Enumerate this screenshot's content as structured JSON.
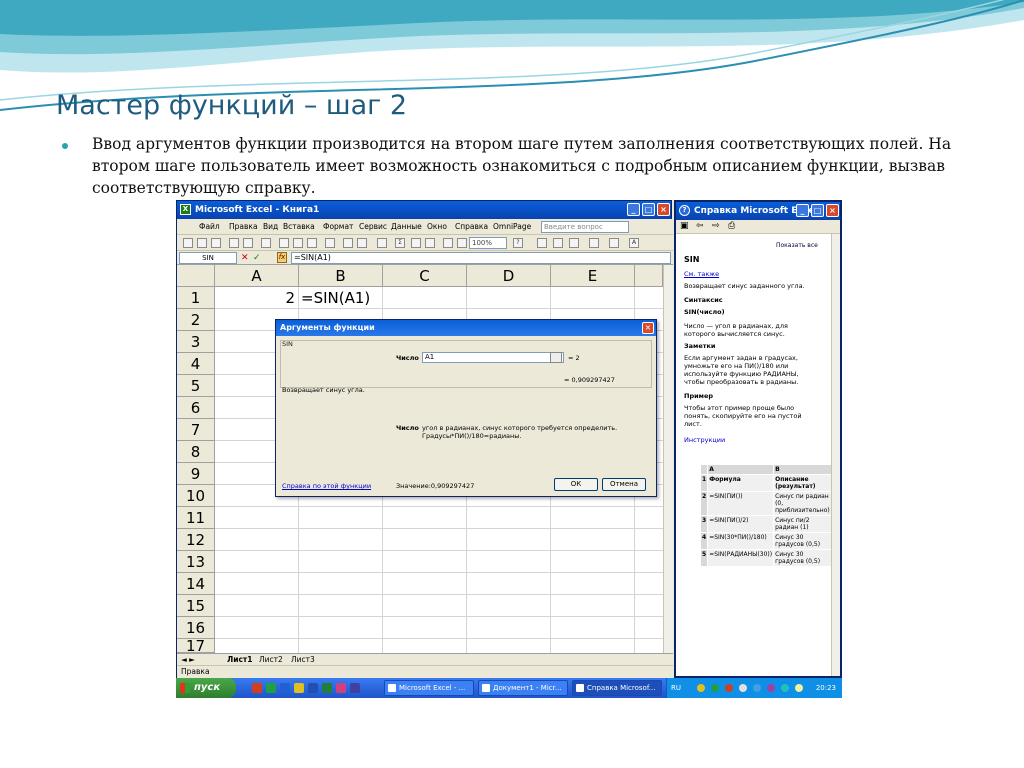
{
  "slide": {
    "title": "Мастер функций – шаг 2",
    "bullet": "Ввод аргументов функции производится на втором шаге путем заполнения соответствующих полей. На втором шаге пользователь имеет возможность ознакомиться с подробным описанием функции, вызвав соответствующую справку."
  },
  "excel": {
    "window_title": "Microsoft Excel - Книга1",
    "menu": [
      "Файл",
      "Правка",
      "Вид",
      "Вставка",
      "Формат",
      "Сервис",
      "Данные",
      "Окно",
      "Справка",
      "OmniPage"
    ],
    "ask_placeholder": "Введите вопрос",
    "zoom": "100%",
    "name_box": "SIN",
    "formula": "=SIN(A1)",
    "columns": [
      "A",
      "B",
      "C",
      "D",
      "E"
    ],
    "rows": [
      "1",
      "2",
      "3",
      "4",
      "5",
      "6",
      "7",
      "8",
      "9",
      "10",
      "11",
      "12",
      "13",
      "14",
      "15",
      "16",
      "17"
    ],
    "cell_a1": "2",
    "cell_b1": "=SIN(A1)",
    "sheets": [
      "Лист1",
      "Лист2",
      "Лист3"
    ],
    "status": "Правка"
  },
  "dialog": {
    "title": "Аргументы функции",
    "group_label": "SIN",
    "arg_label": "Число",
    "arg_value": "A1",
    "arg_result": "= 2",
    "result_line": "= 0,909297427",
    "description": "Возвращает синус угла.",
    "arg_help_label": "Число",
    "arg_help_text": "угол в радианах, синус которого требуется определить. Градусы*ПИ()/180=радианы.",
    "help_link": "Справка по этой функции",
    "value_line": "Значение:0,909297427",
    "ok": "ОК",
    "cancel": "Отмена"
  },
  "help": {
    "window_title": "Справка Microsoft Excel",
    "show_all": "Показать все",
    "heading": "SIN",
    "see_also": "См. также",
    "returns": "Возвращает синус заданного угла.",
    "syntax_h": "Синтаксис",
    "syntax": "SIN(число)",
    "arg_desc": "Число    — угол в радианах, для которого вычисляется синус.",
    "notes_h": "Заметки",
    "notes": "Если аргумент задан в градусах, умножьте его на ПИ()/180 или используйте функцию РАДИАНЫ, чтобы преобразовать в радианы.",
    "example_h": "Пример",
    "example": "Чтобы этот пример проще было понять, скопируйте его на пустой лист.",
    "instructions": "Инструкции",
    "table_cols": [
      "A",
      "B"
    ],
    "table_rows": [
      {
        "n": "1",
        "a": "Формула",
        "b": "Описание (результат)"
      },
      {
        "n": "2",
        "a": "=SIN(ПИ())",
        "b": "Синус пи радиан (0, приблизительно)"
      },
      {
        "n": "3",
        "a": "=SIN(ПИ()/2)",
        "b": "Синус пи/2 радиан (1)"
      },
      {
        "n": "4",
        "a": "=SIN(30*ПИ()/180)",
        "b": "Синус 30 градусов (0,5)"
      },
      {
        "n": "5",
        "a": "=SIN(РАДИАНЫ(30))",
        "b": "Синус 30 градусов (0,5)"
      }
    ]
  },
  "taskbar": {
    "start": "пуск",
    "tasks": [
      "Microsoft Excel - ...",
      "Документ1 - Micr...",
      "Справка Microsof..."
    ],
    "lang": "RU",
    "clock": "20:23"
  }
}
